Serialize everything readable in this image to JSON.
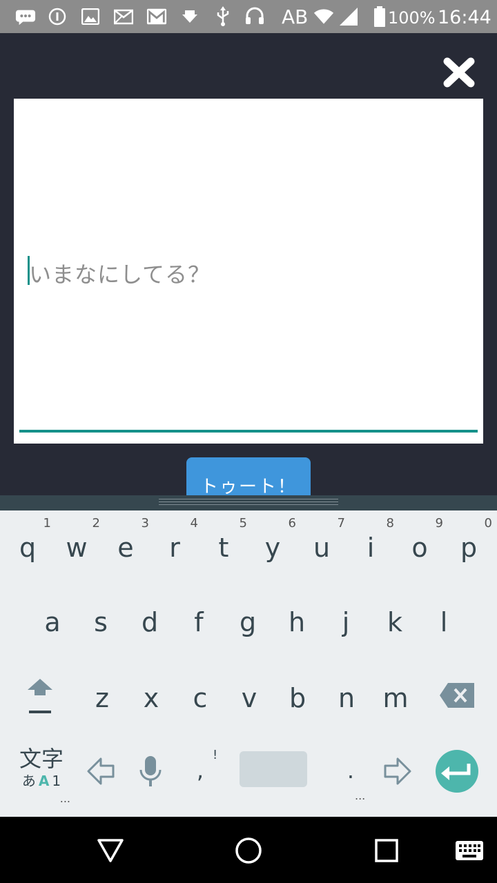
{
  "status_bar": {
    "network": "AB",
    "battery": "100%",
    "time": "16:44",
    "icons": [
      "message-icon",
      "info-icon",
      "image-icon",
      "mail-icon",
      "gmail-icon",
      "download-icon",
      "usb-icon",
      "headset-icon",
      "wifi-icon",
      "signal-icon",
      "battery-icon"
    ]
  },
  "compose": {
    "placeholder": "いまなにしてる？",
    "close_icon": "close-icon",
    "submit_label": "トゥート！",
    "accent_color": "#15918a",
    "button_color": "#3f96dc"
  },
  "keyboard": {
    "row1": [
      {
        "num": "1",
        "ch": "q"
      },
      {
        "num": "2",
        "ch": "w"
      },
      {
        "num": "3",
        "ch": "e"
      },
      {
        "num": "4",
        "ch": "r"
      },
      {
        "num": "5",
        "ch": "t"
      },
      {
        "num": "6",
        "ch": "y"
      },
      {
        "num": "7",
        "ch": "u"
      },
      {
        "num": "8",
        "ch": "i"
      },
      {
        "num": "9",
        "ch": "o"
      },
      {
        "num": "0",
        "ch": "p"
      }
    ],
    "row2": [
      "a",
      "s",
      "d",
      "f",
      "g",
      "h",
      "j",
      "k",
      "l"
    ],
    "row3": [
      "z",
      "x",
      "c",
      "v",
      "b",
      "n",
      "m"
    ],
    "mode_label": "文字",
    "mode_sub": [
      "あ",
      "A",
      "1"
    ],
    "ellipsis": "...",
    "comma": ",",
    "comma_hint": "!",
    "period": ".",
    "period_hint": "...",
    "icons": [
      "shift-icon",
      "backspace-icon",
      "arrow-left-icon",
      "microphone-icon",
      "space-key",
      "arrow-right-icon",
      "enter-icon"
    ]
  },
  "nav_bar": {
    "icons": [
      "back-icon",
      "home-icon",
      "recents-icon",
      "keyboard-switch-icon"
    ]
  }
}
